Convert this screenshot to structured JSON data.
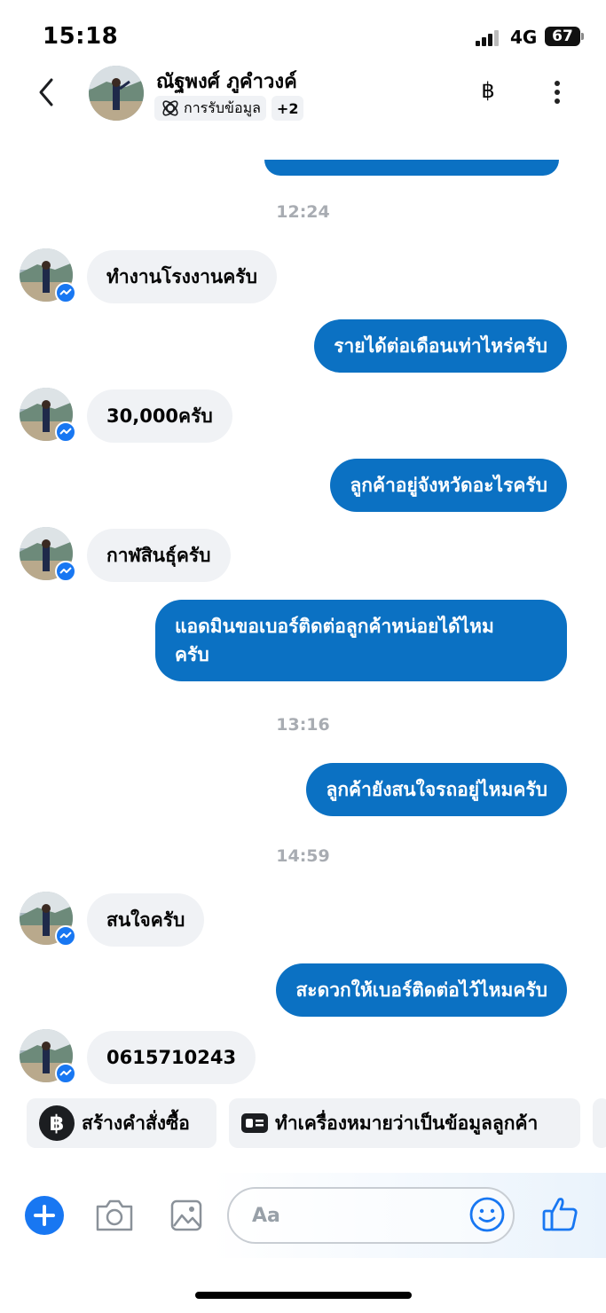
{
  "status": {
    "time": "15:18",
    "network": "4G",
    "battery": "67"
  },
  "header": {
    "contact_name": "ณัฐพงศ์ ภูคำวงค์",
    "tag_label": "การรับข้อมูล",
    "tag_more": "+2",
    "baht_symbol": "฿",
    "icons": [
      "back-icon",
      "baht-icon",
      "more-vertical-icon",
      "info-icon"
    ]
  },
  "messages": [
    {
      "type": "time",
      "text": "12:24"
    },
    {
      "type": "in",
      "text": "ทำงานโรงงานครับ"
    },
    {
      "type": "out",
      "text": "รายได้ต่อเดือนเท่าไหร่ครับ"
    },
    {
      "type": "in",
      "text": "30,000ครับ"
    },
    {
      "type": "out",
      "text": "ลูกค้าอยู่จังหวัดอะไรครับ"
    },
    {
      "type": "in",
      "text": "กาฬสินธุ์ครับ"
    },
    {
      "type": "out",
      "line1": "แอดมินขอเบอร์ติดต่อลูกค้าหน่อยได้ไหม",
      "line2": "ครับ"
    },
    {
      "type": "time",
      "text": "13:16"
    },
    {
      "type": "out",
      "text": "ลูกค้ายังสนใจรถอยู่ไหมครับ"
    },
    {
      "type": "time",
      "text": "14:59"
    },
    {
      "type": "in",
      "text": "สนใจครับ"
    },
    {
      "type": "out",
      "text": "สะดวกให้เบอร์ติดต่อไว้ไหมครับ"
    },
    {
      "type": "in",
      "text": "0615710243"
    }
  ],
  "quick_replies": {
    "create_order": "สร้างคำสั่งซื้อ",
    "mark_customer": "ทำเครื่องหมายว่าเป็นข้อมูลลูกค้า"
  },
  "composer": {
    "placeholder": "Aa"
  },
  "colors": {
    "outgoing": "#0b71c3",
    "incoming": "#f0f2f5",
    "accent": "#1877f2"
  }
}
